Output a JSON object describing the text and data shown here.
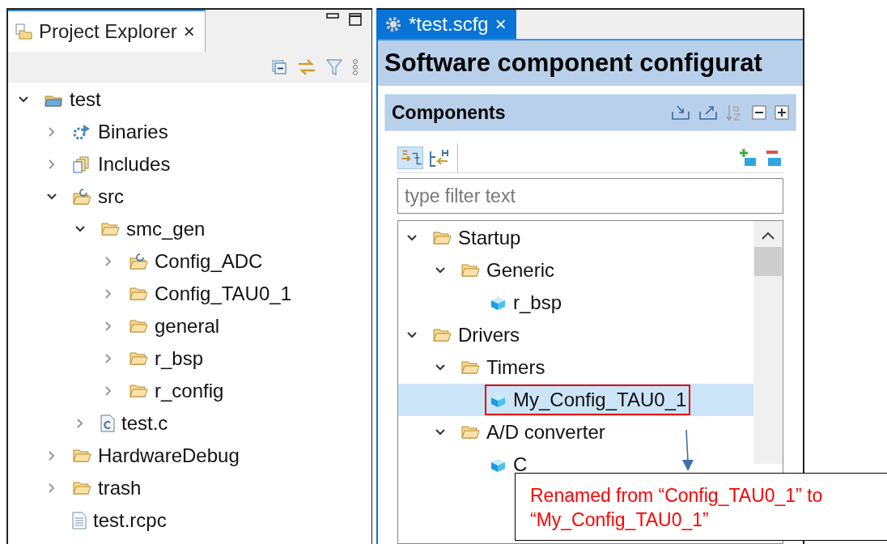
{
  "explorer": {
    "tab": {
      "label": "Project Explorer",
      "close": "×",
      "selected": false
    },
    "tree": [
      {
        "label": "test",
        "kind": "project",
        "expanded": true,
        "children": [
          {
            "label": "Binaries",
            "kind": "binaries",
            "expanded": false
          },
          {
            "label": "Includes",
            "kind": "includes",
            "expanded": false
          },
          {
            "label": "src",
            "kind": "source-folder",
            "expanded": true,
            "children": [
              {
                "label": "smc_gen",
                "kind": "folder",
                "expanded": true,
                "children": [
                  {
                    "label": "Config_ADC",
                    "kind": "source-folder",
                    "expanded": false
                  },
                  {
                    "label": "Config_TAU0_1",
                    "kind": "folder",
                    "expanded": false
                  },
                  {
                    "label": "general",
                    "kind": "folder",
                    "expanded": false
                  },
                  {
                    "label": "r_bsp",
                    "kind": "folder",
                    "expanded": false
                  },
                  {
                    "label": "r_config",
                    "kind": "folder",
                    "expanded": false
                  }
                ]
              },
              {
                "label": "test.c",
                "kind": "c-file",
                "expanded": false
              }
            ]
          },
          {
            "label": "HardwareDebug",
            "kind": "folder",
            "expanded": false
          },
          {
            "label": "trash",
            "kind": "folder",
            "expanded": false
          },
          {
            "label": "test.rcpc",
            "kind": "file"
          }
        ]
      }
    ]
  },
  "editor": {
    "tab": {
      "label": "*test.scfg",
      "close": "×",
      "selected": true
    },
    "title": "Software component configurat",
    "section": "Components",
    "filter": {
      "placeholder": "type filter text"
    },
    "tree": [
      {
        "label": "Startup",
        "kind": "folder",
        "expanded": true,
        "selected": false,
        "children": [
          {
            "label": "Generic",
            "kind": "folder",
            "expanded": true,
            "selected": false,
            "children": [
              {
                "label": "r_bsp",
                "kind": "component",
                "selected": false
              }
            ]
          }
        ]
      },
      {
        "label": "Drivers",
        "kind": "folder",
        "expanded": true,
        "selected": false,
        "children": [
          {
            "label": "Timers",
            "kind": "folder",
            "expanded": true,
            "selected": false,
            "children": [
              {
                "label": "My_Config_TAU0_1",
                "kind": "component",
                "selected": true
              }
            ]
          },
          {
            "label": "A/D converter",
            "kind": "folder",
            "expanded": true,
            "selected": false,
            "children": [
              {
                "label": "C",
                "kind": "component",
                "selected": false
              }
            ]
          }
        ]
      }
    ]
  },
  "callout": {
    "text": "Renamed from “Config_TAU0_1” to “My_Config_TAU0_1”"
  }
}
